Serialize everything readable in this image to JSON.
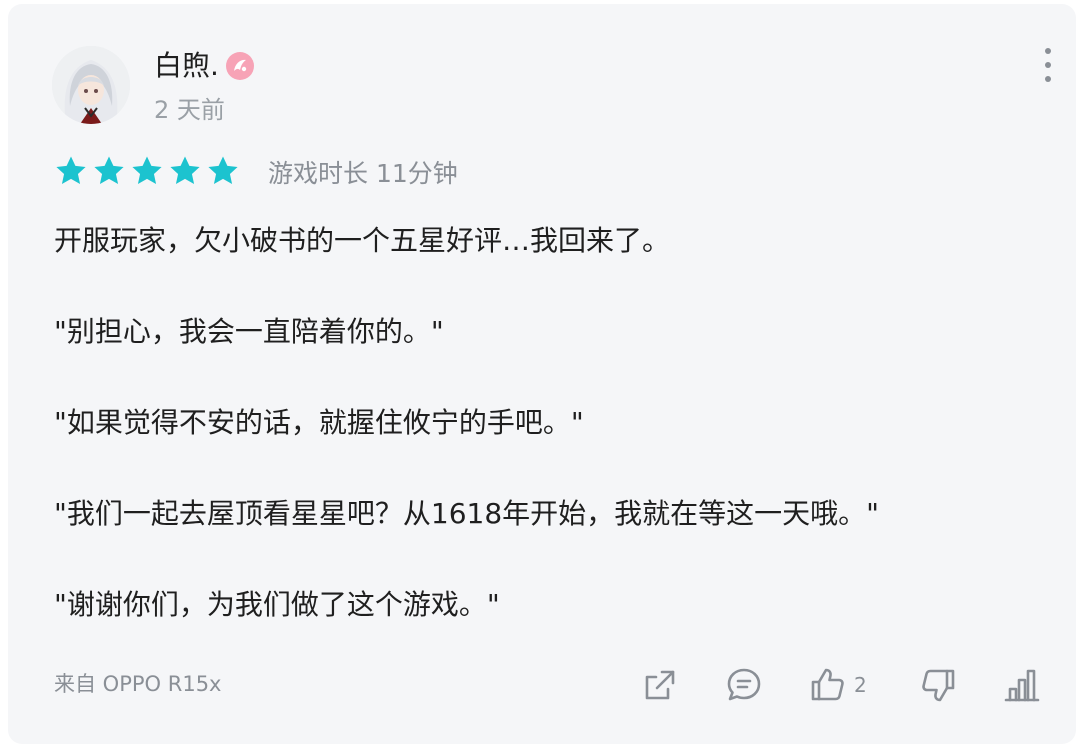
{
  "user": {
    "name": "白煦.",
    "time_ago": "2 天前"
  },
  "rating": {
    "stars": 5,
    "max": 5,
    "star_color": "#1cc3cf",
    "playtime": "游戏时长 11分钟"
  },
  "review": {
    "paragraphs": [
      "开服玩家，欠小破书的一个五星好评…我回来了。",
      "\"别担心，我会一直陪着你的。\"",
      "\"如果觉得不安的话，就握住攸宁的手吧。\"",
      "\"我们一起去屋顶看星星吧？从1618年开始，我就在等这一天哦。\"",
      "\"谢谢你们，为我们做了这个游戏。\""
    ]
  },
  "footer": {
    "device": "来自 OPPO R15x",
    "like_count": "2",
    "icon_color": "#8a8f96"
  }
}
